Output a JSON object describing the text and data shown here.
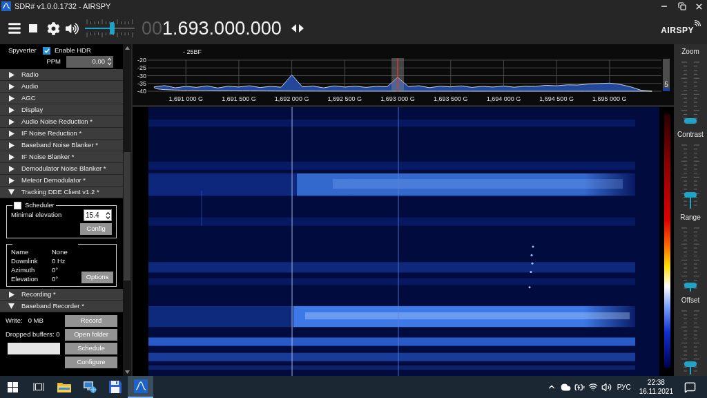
{
  "window": {
    "title": "SDR# v1.0.0.1732 - AIRSPY"
  },
  "toolbar": {
    "volume": {
      "level": 0.56
    },
    "frequency": {
      "prefix": "00",
      "value": "1.693.000.000"
    },
    "logo": "AIRSPY"
  },
  "source": {
    "label": "Spyverter",
    "option": {
      "label": "Enable HDR",
      "checked": true
    },
    "ppm": {
      "label": "PPM",
      "value": "0,00"
    }
  },
  "panels": [
    {
      "title": "Radio",
      "expanded": false
    },
    {
      "title": "Audio",
      "expanded": false
    },
    {
      "title": "AGC",
      "expanded": false
    },
    {
      "title": "Display",
      "expanded": false
    },
    {
      "title": "Audio Noise Reduction *",
      "expanded": false
    },
    {
      "title": "IF Noise Reduction *",
      "expanded": false
    },
    {
      "title": "Baseband Noise Blanker *",
      "expanded": false
    },
    {
      "title": "IF Noise Blanker *",
      "expanded": false
    },
    {
      "title": "Demodulator Noise Blanker *",
      "expanded": false
    },
    {
      "title": "Meteor Demodulator *",
      "expanded": false
    },
    {
      "title": "Tracking DDE Client v1.2 *",
      "expanded": true,
      "body": {
        "kind": "tracking",
        "scheduler": {
          "label": "Scheduler",
          "checked": false
        },
        "elevation": {
          "label": "Minimal elevation",
          "value": "15.4"
        },
        "config_button": {
          "label": "Config",
          "disabled": true
        },
        "info": [
          {
            "label": "Name",
            "value": "None"
          },
          {
            "label": "Downlink",
            "value": "0 Hz"
          },
          {
            "label": "Azimuth",
            "value": "0°"
          },
          {
            "label": "Elevation",
            "value": "0°"
          }
        ],
        "options_button": {
          "label": "Options",
          "disabled": true
        }
      }
    },
    {
      "title": "Recording *",
      "expanded": false
    },
    {
      "title": "Baseband Recorder *",
      "expanded": true,
      "body": {
        "kind": "recorder",
        "write_label": "Write:",
        "write_value": "0 MB",
        "dropped": "Dropped buffers: 0",
        "buttons": [
          {
            "label": "Record",
            "disabled": true
          },
          {
            "label": "Open folder",
            "disabled": true
          },
          {
            "label": "Schedule",
            "disabled": true
          },
          {
            "label": "Configure",
            "disabled": true
          }
        ]
      }
    }
  ],
  "spectrum": {
    "marker": "- 25BF",
    "chart_data": {
      "type": "area",
      "categories": [
        null,
        null,
        null,
        "1,691 000 G",
        null,
        null,
        null,
        null,
        "1,691 500 G",
        null,
        null,
        null,
        null,
        "1,692 000 G",
        null,
        null,
        null,
        null,
        "1,692 500 G",
        null,
        null,
        null,
        null,
        "1,693 000 G",
        null,
        null,
        null,
        null,
        "1,693 500 G",
        null,
        null,
        null,
        null,
        "1,694 000 G",
        null,
        null,
        null,
        null,
        "1,694 500 G",
        null,
        null,
        null,
        null,
        "1,695 000 G",
        null,
        null,
        null,
        null
      ],
      "series": [
        {
          "color": "#23479a",
          "values": [
            -37.2,
            -36.4,
            -37.8,
            -36.9,
            -37.5,
            -36.6,
            -37.9,
            -36.8,
            -37.3,
            -36.5,
            -37.6,
            -36.9,
            -37.4,
            -29.5,
            -37.2,
            -36.7,
            -37.8,
            -36.6,
            -37.3,
            -36.8,
            -37.5,
            -36.9,
            -37.1,
            -31.0,
            -37.0,
            -36.5,
            -37.7,
            -36.8,
            -37.2,
            -36.6,
            -37.5,
            -36.9,
            -37.3,
            -36.7,
            -37.4,
            -36.8,
            -36.9,
            -36.2,
            -36.5,
            -35.9,
            -36.0,
            -35.4,
            -35.1,
            -34.8,
            -35.6,
            -37.2,
            -39.4,
            -40.0
          ]
        }
      ],
      "ylim": [
        -40,
        -20
      ],
      "yticks": [
        -40,
        -35,
        -30,
        -25,
        -20
      ],
      "grid": true,
      "ref_lines": [
        {
          "axis": "x",
          "value": "1,693 000 G",
          "color": "#ff2a2a"
        }
      ]
    },
    "meter": {
      "reading": "5",
      "level": 0.1
    }
  },
  "side_sliders": [
    {
      "label": "Zoom",
      "level": 0.03
    },
    {
      "label": "Contrast",
      "level": 0.18
    },
    {
      "label": "Range",
      "level": 0.06
    },
    {
      "label": "Offset",
      "level": 0.12
    }
  ],
  "taskbar": {
    "apps": [
      {
        "kind": "folder",
        "selected": false
      },
      {
        "kind": "network",
        "selected": false
      },
      {
        "kind": "floppy",
        "selected": false
      },
      {
        "kind": "sdr",
        "selected": true
      }
    ],
    "language": "РУС",
    "time": "22:38",
    "date": "16.11.2021"
  }
}
